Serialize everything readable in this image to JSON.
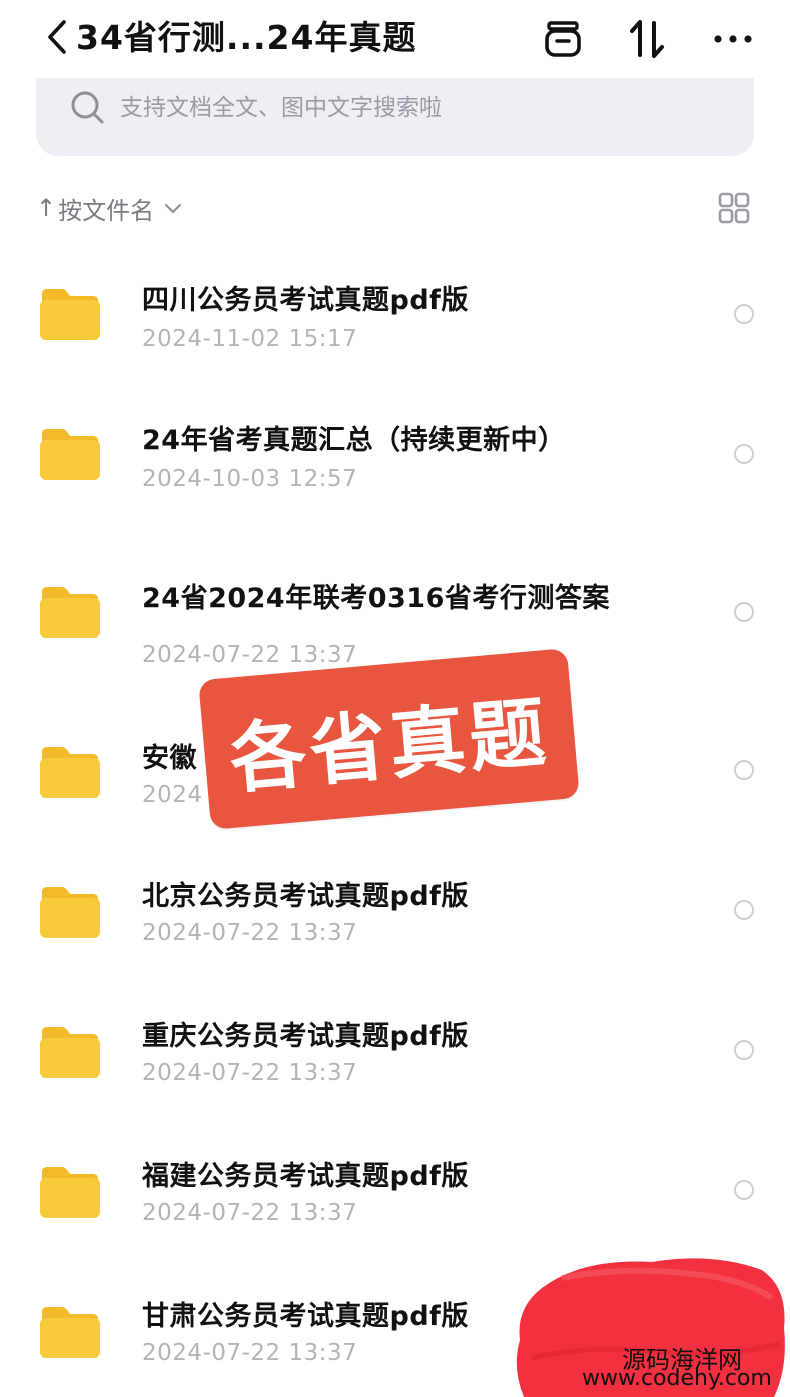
{
  "header": {
    "back_icon": "chevron-left-icon",
    "title": "34省行测...24年真题",
    "archive_icon": "archive-box-icon",
    "sort_icon": "sort-updown-icon",
    "more_icon": "more-horizontal-icon"
  },
  "search": {
    "icon": "search-icon",
    "placeholder": "支持文档全文、图中文字搜索啦",
    "value": ""
  },
  "sort": {
    "arrow": "↑",
    "label": "按文件名",
    "chevron_icon": "chevron-down-icon",
    "grid_icon": "grid-view-icon"
  },
  "files": [
    {
      "name": "四川公务员考试真题pdf版",
      "date": "2024-11-02 15:17",
      "icon": "folder-icon"
    },
    {
      "name": "24年省考真题汇总（持续更新中）",
      "date": "2024-10-03 12:57",
      "icon": "folder-icon"
    },
    {
      "name": "24省2024年联考0316省考行测答案",
      "date": "2024-07-22 13:37",
      "icon": "folder-icon"
    },
    {
      "name": "安徽",
      "date": "2024",
      "icon": "folder-icon"
    },
    {
      "name": "北京公务员考试真题pdf版",
      "date": "2024-07-22 13:37",
      "icon": "folder-icon"
    },
    {
      "name": "重庆公务员考试真题pdf版",
      "date": "2024-07-22 13:37",
      "icon": "folder-icon"
    },
    {
      "name": "福建公务员考试真题pdf版",
      "date": "2024-07-22 13:37",
      "icon": "folder-icon"
    },
    {
      "name": "甘肃公务员考试真题pdf版",
      "date": "2024-07-22 13:37",
      "icon": "folder-icon"
    }
  ],
  "overlay": {
    "text": "各省真题",
    "color": "#e8563f"
  },
  "watermark": {
    "name": "源码海洋网",
    "url": "www.codehy.com",
    "color": "#f2303f"
  },
  "colors": {
    "folder": "#f8c93a",
    "folder_tab": "#f2b928",
    "date_text": "#b3b4ba",
    "search_bg": "#eeeff4"
  }
}
